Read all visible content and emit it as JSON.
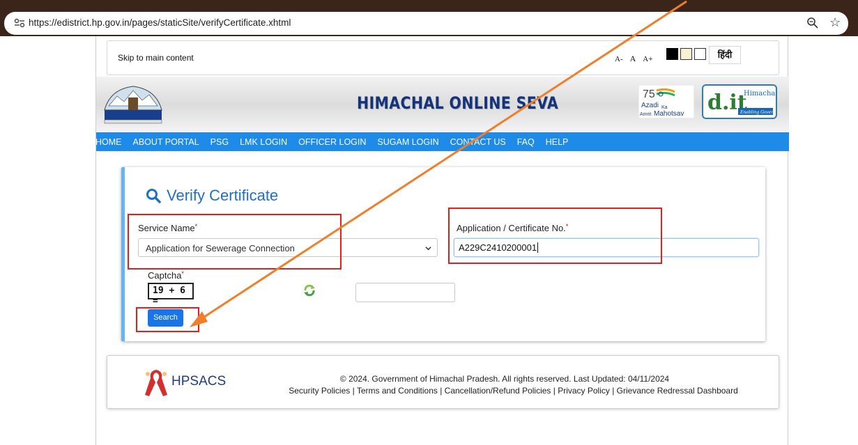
{
  "browser": {
    "url": "https://edistrict.hp.gov.in/pages/staticSite/verifyCertificate.xhtml"
  },
  "toolbar": {
    "skip_link": "Skip to main content",
    "font_decrease": "A-",
    "font_normal": "A",
    "font_increase": "A+",
    "language": "हिंदी"
  },
  "header": {
    "title": "HIMACHAL ONLINE SEVA",
    "azadi_text": "Azadi Ka Amrit Mahotsav",
    "dit_text": "Himachal"
  },
  "nav": {
    "items": [
      "HOME",
      "ABOUT PORTAL",
      "PSG",
      "LMK LOGIN",
      "OFFICER LOGIN",
      "SUGAM LOGIN",
      "CONTACT US",
      "FAQ",
      "HELP"
    ]
  },
  "form": {
    "title": "Verify Certificate",
    "service_label": "Service Name",
    "service_value": "Application for Sewerage Connection",
    "app_label": "Application / Certificate No.",
    "app_value": "A229C2410200001",
    "captcha_label": "Captcha",
    "captcha_text": "19 + 6 =",
    "search_label": "Search",
    "required_mark": "*"
  },
  "footer": {
    "logo_text": "HPSACS",
    "copyright": "© 2024. Government of Himachal Pradesh. All rights reserved. Last Updated: 04/11/2024",
    "links": "Security Policies | Terms and Conditions | Cancellation/Refund Policies | Privacy Policy | Grievance Redressal Dashboard"
  },
  "annotation_colors": {
    "box": "#e0201c",
    "arrow": "#f07e2a"
  }
}
